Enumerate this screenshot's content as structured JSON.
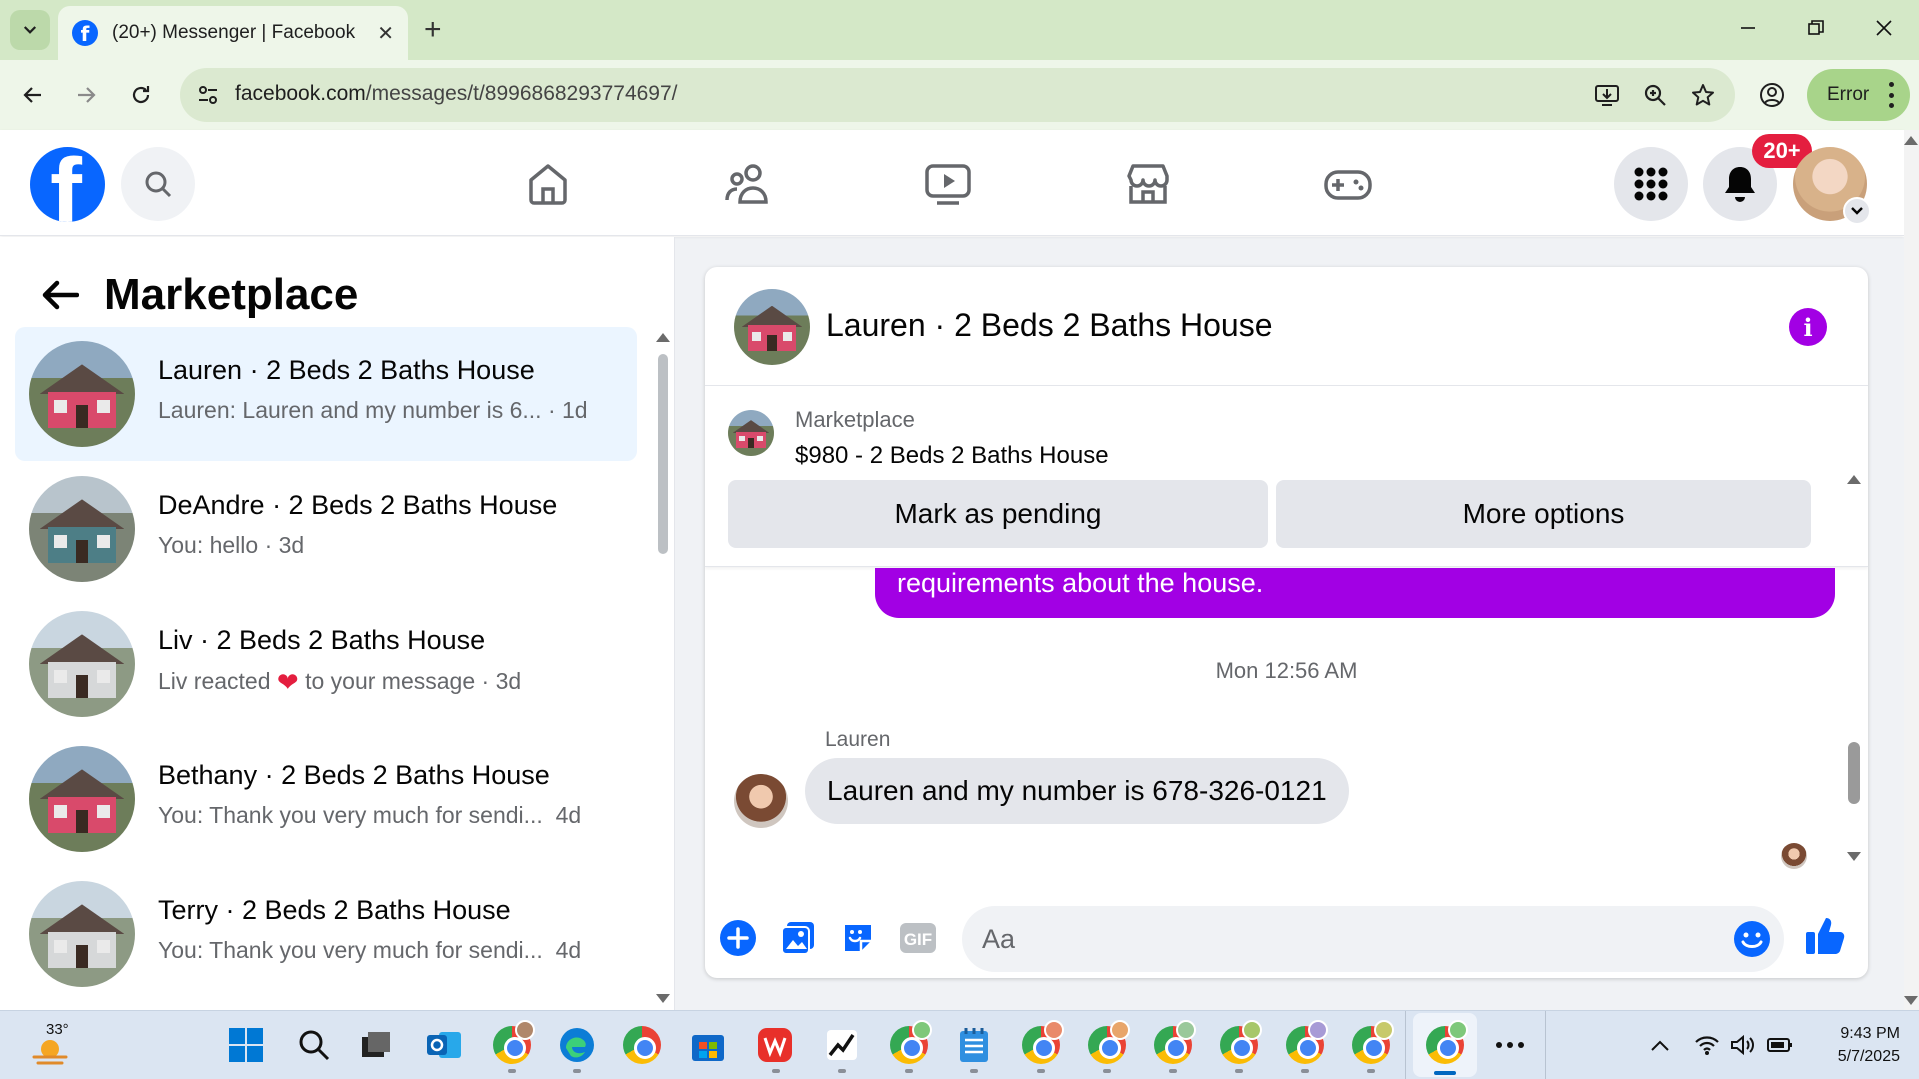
{
  "browser": {
    "tab_title": "(20+) Messenger | Facebook",
    "url_host": "facebook.com",
    "url_path": "/messages/t/8996868293774697/",
    "error_label": "Error"
  },
  "header": {
    "notification_count": "20+"
  },
  "sidebar": {
    "title": "Marketplace",
    "conversations": [
      {
        "name": "Lauren · 2 Beds 2 Baths House",
        "preview": "Lauren: Lauren and my number is 6...",
        "time": "· 1d"
      },
      {
        "name": "DeAndre · 2 Beds 2 Baths House",
        "preview": "You: hello",
        "time": "· 3d"
      },
      {
        "name": "Liv · 2 Beds 2 Baths House",
        "preview_before": "Liv reacted",
        "preview_after": "to your message",
        "time": "· 3d"
      },
      {
        "name": "Bethany · 2 Beds 2 Baths House",
        "preview": "You: Thank you very much for sendi...",
        "time": "4d"
      },
      {
        "name": "Terry · 2 Beds 2 Baths House",
        "preview": "You: Thank you very much for sendi...",
        "time": "4d"
      }
    ]
  },
  "chat": {
    "title": "Lauren · 2 Beds 2 Baths House",
    "listing_label": "Marketplace",
    "listing_price": "$980 - 2 Beds 2 Baths House",
    "mark_pending_label": "Mark as pending",
    "more_options_label": "More options",
    "sent_fragment": "requirements about the house.",
    "timestamp": "Mon 12:56 AM",
    "sender": "Lauren",
    "received_message": "Lauren and my number is 678-326-0121",
    "input_placeholder": "Aa"
  },
  "taskbar": {
    "temperature": "33°",
    "time": "9:43 PM",
    "date": "5/7/2025"
  },
  "colors": {
    "fb_blue": "#0866ff",
    "messenger_purple": "#a200e4",
    "notification_red": "#e41e3f",
    "active_conversation": "#ebf5ff"
  }
}
